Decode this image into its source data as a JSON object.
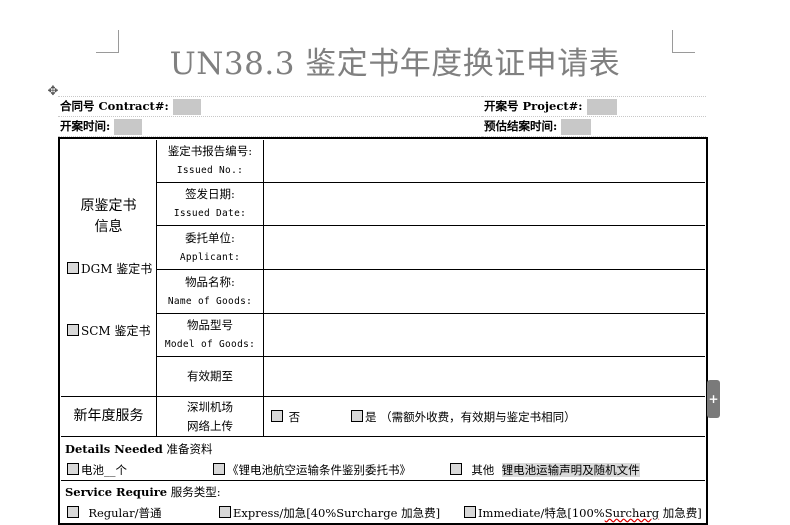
{
  "title": "UN38.3 鉴定书年度换证申请表",
  "header": {
    "contract_label": "合同号 Contract#:",
    "project_label": "开案号 Project#:",
    "open_time_label": "开案时间:",
    "est_end_label": "预估结案时间:"
  },
  "original_cert": {
    "group_label": "原鉴定书\n信息",
    "dgm_label": "DGM 鉴定书",
    "scm_label": "SCM 鉴定书",
    "fields": [
      {
        "cn": "鉴定书报告编号:",
        "en": "Issued No.:"
      },
      {
        "cn": "签发日期:",
        "en": "Issued Date:"
      },
      {
        "cn": "委托单位:",
        "en": "Applicant:"
      },
      {
        "cn": "物品名称:",
        "en": "Name of Goods:"
      },
      {
        "cn": "物品型号",
        "en": "Model of Goods:"
      },
      {
        "cn": "有效期至",
        "en": ""
      }
    ]
  },
  "new_year_service": {
    "label": "新年度服务",
    "sub_label_1": "深圳机场",
    "sub_label_2": "网络上传",
    "no_option": "否",
    "yes_option": "是 （需额外收费，有效期与鉴定书相同）"
  },
  "details": {
    "label": "Details Needed",
    "label_cn": "准备资料",
    "battery": "电池__个",
    "letter": "《锂电池航空运输条件鉴别委托书》",
    "other": "其他",
    "other_value": "锂电池运输声明及随机文件"
  },
  "service": {
    "label": "Service Require",
    "label_cn": "服务类型:",
    "regular": "Regular/普通",
    "express": "Express/加急[40%Surcharge 加急费]",
    "immediate_prefix": "Immediate/特急[100%",
    "immediate_misspelled": "Surcharg",
    "immediate_suffix": " 加急费]"
  },
  "icons": {
    "move_handle": "move-handle-icon",
    "side_tab": "plus-icon"
  }
}
